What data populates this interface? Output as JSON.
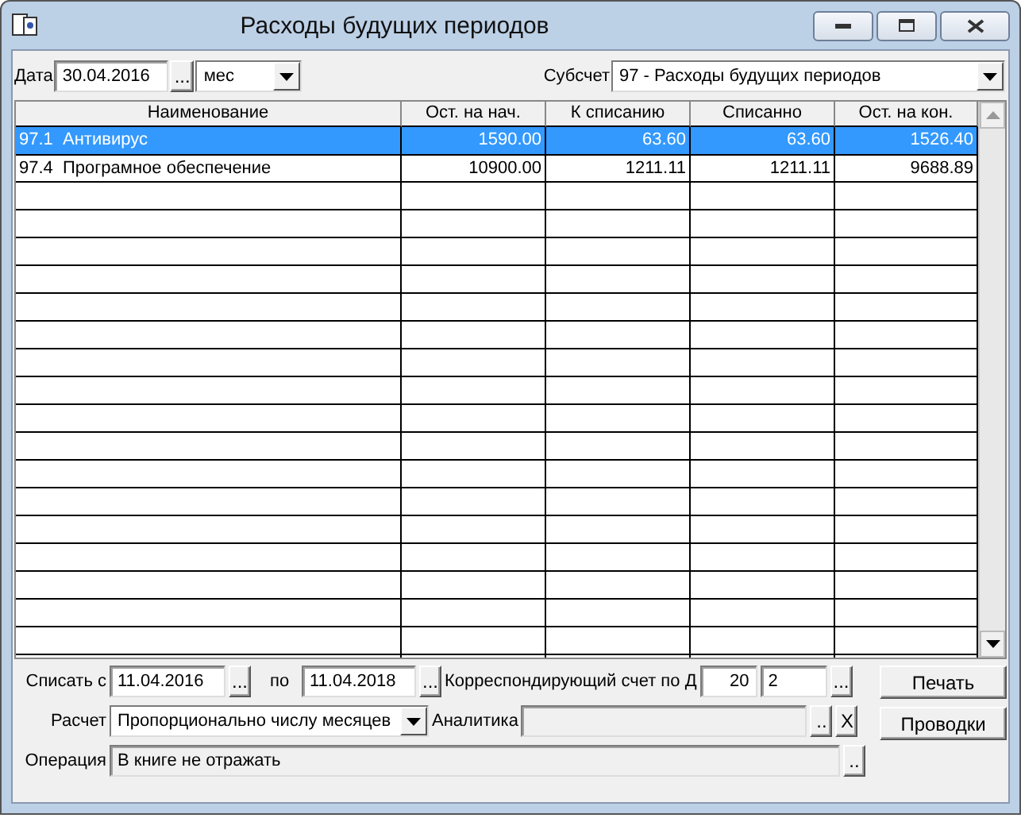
{
  "window": {
    "title": "Расходы будущих периодов"
  },
  "toolbar": {
    "date_label": "Дата",
    "date": "30.04.2016",
    "date_button": "...",
    "period": "мес",
    "subaccount_label": "Субсчет",
    "subaccount": "97 - Расходы будущих периодов"
  },
  "table": {
    "columns": [
      "Наименование",
      "Ост. на нач.",
      "К списанию",
      "Списанно",
      "Ост. на кон."
    ],
    "rows": [
      {
        "cells": [
          "97.1  Антивирус",
          "1590.00",
          "63.60",
          "63.60",
          "1526.40"
        ],
        "selected": true
      },
      {
        "cells": [
          "97.4  Програмное обеспечение",
          "10900.00",
          "1211.11",
          "1211.11",
          "9688.89"
        ],
        "selected": false
      }
    ]
  },
  "form": {
    "from_label": "Списать с",
    "from": "11.04.2016",
    "from_button": "...",
    "to_label": "по",
    "to": "11.04.2018",
    "to_button": "...",
    "account_label": "Корреспондирующий счет по Д",
    "account": "20",
    "subaccount": "2",
    "account_button": "...",
    "calc_label": "Расчет",
    "calc": "Пропорционально числу месяцев",
    "analytics_label": "Аналитика",
    "analytics_disabled": true,
    "analytics_button": "..",
    "clear_button": "X",
    "operation_label": "Операция",
    "operation": "В книге не отражать",
    "operation_disabled": true,
    "operation_button": ".."
  },
  "buttons": [
    "Печать",
    "Проводки"
  ]
}
